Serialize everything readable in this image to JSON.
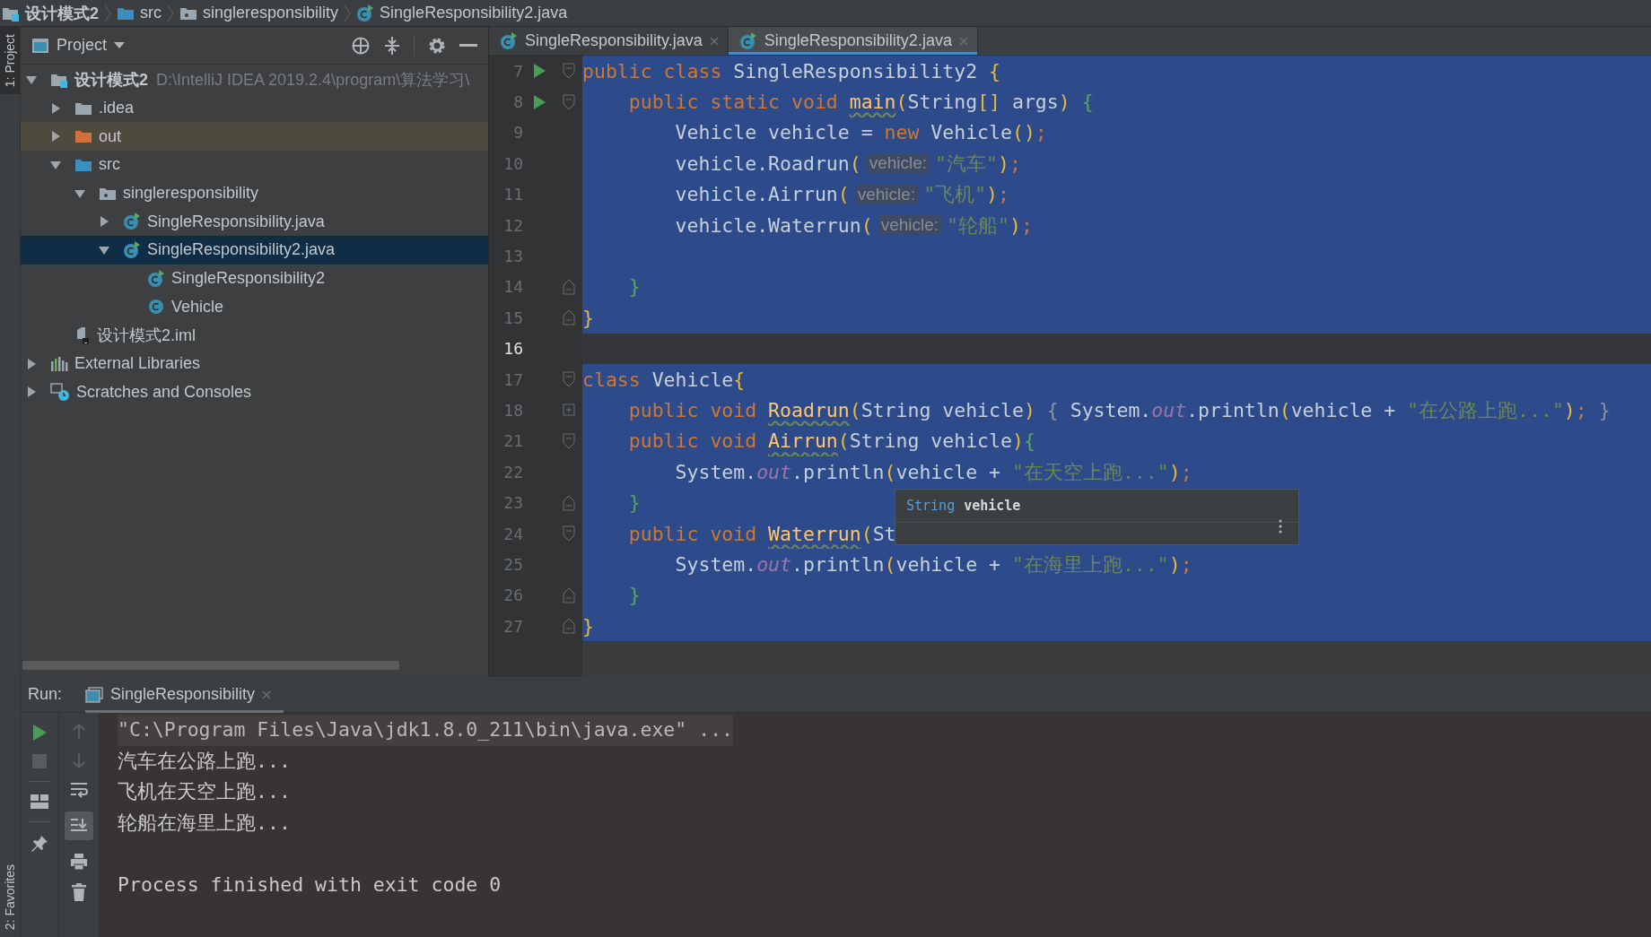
{
  "breadcrumb": [
    {
      "label": "设计模式2",
      "kind": "module"
    },
    {
      "label": "src",
      "kind": "source-folder"
    },
    {
      "label": "singleresponsibility",
      "kind": "package"
    },
    {
      "label": "SingleResponsibility2.java",
      "kind": "java-file"
    }
  ],
  "left_stripe": [
    {
      "label": "1: Project",
      "selected": true
    },
    {
      "label": "2: Favorites",
      "selected": false
    }
  ],
  "project": {
    "title": "Project",
    "tree": [
      {
        "label": "设计模式2",
        "kind": "module",
        "path": "D:\\IntelliJ IDEA 2019.2.4\\program\\算法学习\\",
        "expanded": true,
        "selected": false,
        "children": [
          {
            "label": ".idea",
            "kind": "folder",
            "expanded": false,
            "selected": false
          },
          {
            "label": "out",
            "kind": "excluded-folder",
            "expanded": false,
            "selected": false
          },
          {
            "label": "src",
            "kind": "source-folder",
            "expanded": true,
            "selected": false,
            "children": [
              {
                "label": "singleresponsibility",
                "kind": "package",
                "expanded": true,
                "selected": false,
                "children": [
                  {
                    "label": "SingleResponsibility.java",
                    "kind": "java-file",
                    "expanded": false,
                    "selected": false
                  },
                  {
                    "label": "SingleResponsibility2.java",
                    "kind": "java-file",
                    "expanded": true,
                    "selected": true,
                    "children": [
                      {
                        "label": "SingleResponsibility2",
                        "kind": "main-class",
                        "selected": false
                      },
                      {
                        "label": "Vehicle",
                        "kind": "class",
                        "selected": false
                      }
                    ]
                  }
                ]
              }
            ]
          },
          {
            "label": "设计模式2.iml",
            "kind": "iml",
            "selected": false
          }
        ]
      },
      {
        "label": "External Libraries",
        "kind": "libraries",
        "expanded": false,
        "selected": false
      },
      {
        "label": "Scratches and Consoles",
        "kind": "scratches",
        "expanded": false,
        "selected": false
      }
    ]
  },
  "editor": {
    "tabs": [
      {
        "label": "SingleResponsibility.java",
        "selected": false
      },
      {
        "label": "SingleResponsibility2.java",
        "selected": true
      }
    ],
    "lines": [
      {
        "number": "7",
        "run": true,
        "kind": "fold-start",
        "selected": true,
        "tokens": [
          {
            "kind": "kw",
            "text": "public class "
          },
          {
            "kind": "id",
            "text": "SingleResponsibility2 "
          },
          {
            "kind": "p1",
            "text": "{"
          }
        ]
      },
      {
        "number": "8",
        "run": true,
        "kind": "fold-start",
        "selected": true,
        "tokens": [
          {
            "kind": "kw",
            "text": "    public static void "
          },
          {
            "kind": "decl",
            "text": "main"
          },
          {
            "kind": "p1",
            "text": "("
          },
          {
            "kind": "id",
            "text": "String"
          },
          {
            "kind": "p1",
            "text": "[]"
          },
          {
            "kind": "id",
            "text": " args"
          },
          {
            "kind": "p1",
            "text": ")"
          },
          {
            "kind": "p2",
            "text": " {"
          }
        ]
      },
      {
        "number": "9",
        "run": false,
        "kind": "plain",
        "selected": true,
        "tokens": [
          {
            "kind": "id",
            "text": "        Vehicle vehicle = "
          },
          {
            "kind": "kw",
            "text": "new "
          },
          {
            "kind": "id",
            "text": "Vehicle"
          },
          {
            "kind": "p1",
            "text": "()"
          },
          {
            "kind": "punct",
            "text": ";"
          }
        ]
      },
      {
        "number": "10",
        "run": false,
        "kind": "plain",
        "selected": true,
        "tokens": [
          {
            "kind": "id",
            "text": "        vehicle.Roadrun"
          },
          {
            "kind": "p1",
            "text": "("
          },
          {
            "kind": "hint",
            "text": "vehicle:"
          },
          {
            "kind": "str",
            "text": "\"汽车\""
          },
          {
            "kind": "p1",
            "text": ")"
          },
          {
            "kind": "punct",
            "text": ";"
          }
        ]
      },
      {
        "number": "11",
        "run": false,
        "kind": "plain",
        "selected": true,
        "tokens": [
          {
            "kind": "id",
            "text": "        vehicle.Airrun"
          },
          {
            "kind": "p1",
            "text": "("
          },
          {
            "kind": "hint",
            "text": "vehicle:"
          },
          {
            "kind": "str",
            "text": "\"飞机\""
          },
          {
            "kind": "p1",
            "text": ")"
          },
          {
            "kind": "punct",
            "text": ";"
          }
        ]
      },
      {
        "number": "12",
        "run": false,
        "kind": "plain",
        "selected": true,
        "tokens": [
          {
            "kind": "id",
            "text": "        vehicle.Waterrun"
          },
          {
            "kind": "p1",
            "text": "("
          },
          {
            "kind": "hint",
            "text": "vehicle:"
          },
          {
            "kind": "str",
            "text": "\"轮船\""
          },
          {
            "kind": "p1",
            "text": ")"
          },
          {
            "kind": "punct",
            "text": ";"
          }
        ]
      },
      {
        "number": "13",
        "run": false,
        "kind": "plain",
        "selected": true
      },
      {
        "number": "14",
        "run": false,
        "kind": "fold-end",
        "selected": true,
        "tokens": [
          {
            "kind": "p2",
            "text": "    }"
          }
        ]
      },
      {
        "number": "15",
        "run": false,
        "kind": "fold-end",
        "selected": true,
        "tokens": [
          {
            "kind": "p1",
            "text": "}"
          }
        ]
      },
      {
        "number": "16",
        "run": false,
        "kind": "plain",
        "selected": false
      },
      {
        "number": "17",
        "run": false,
        "kind": "fold-start",
        "selected": true,
        "tokens": [
          {
            "kind": "kw",
            "text": "class "
          },
          {
            "kind": "id",
            "text": "Vehicle"
          },
          {
            "kind": "p1",
            "text": "{"
          }
        ]
      },
      {
        "number": "18",
        "run": false,
        "kind": "folded",
        "selected": true,
        "tokens": [
          {
            "kind": "kw",
            "text": "    public void "
          },
          {
            "kind": "decl",
            "text": "Roadrun"
          },
          {
            "kind": "p1",
            "text": "("
          },
          {
            "kind": "id",
            "text": "String vehicle"
          },
          {
            "kind": "p1",
            "text": ")"
          },
          {
            "kind": "folded",
            "text": " { "
          },
          {
            "kind": "id",
            "text": "System."
          },
          {
            "kind": "field",
            "text": "out"
          },
          {
            "kind": "id",
            "text": ".println"
          },
          {
            "kind": "p1",
            "text": "("
          },
          {
            "kind": "id",
            "text": "vehicle + "
          },
          {
            "kind": "str",
            "text": "\"在公路上跑...\""
          },
          {
            "kind": "p1",
            "text": ")"
          },
          {
            "kind": "punct",
            "text": ";"
          },
          {
            "kind": "folded",
            "text": " }"
          }
        ]
      },
      {
        "number": "21",
        "run": false,
        "kind": "fold-start",
        "selected": true,
        "tokens": [
          {
            "kind": "kw",
            "text": "    public void "
          },
          {
            "kind": "decl",
            "text": "Airrun"
          },
          {
            "kind": "p1",
            "text": "("
          },
          {
            "kind": "id",
            "text": "String vehicle"
          },
          {
            "kind": "p1",
            "text": ")"
          },
          {
            "kind": "p2",
            "text": "{"
          }
        ]
      },
      {
        "number": "22",
        "run": false,
        "kind": "plain",
        "selected": true,
        "tokens": [
          {
            "kind": "id",
            "text": "        System."
          },
          {
            "kind": "field",
            "text": "out"
          },
          {
            "kind": "id",
            "text": ".println"
          },
          {
            "kind": "p1",
            "text": "("
          },
          {
            "kind": "id",
            "text": "vehicle + "
          },
          {
            "kind": "str",
            "text": "\"在天空上跑...\""
          },
          {
            "kind": "p1",
            "text": ")"
          },
          {
            "kind": "punct",
            "text": ";"
          }
        ]
      },
      {
        "number": "23",
        "run": false,
        "kind": "fold-end",
        "selected": true,
        "tokens": [
          {
            "kind": "p2",
            "text": "    }"
          }
        ]
      },
      {
        "number": "24",
        "run": false,
        "kind": "fold-start",
        "selected": true,
        "tokens": [
          {
            "kind": "kw",
            "text": "    public void "
          },
          {
            "kind": "decl",
            "text": "Waterrun"
          },
          {
            "kind": "p1",
            "text": "("
          },
          {
            "kind": "id",
            "text": "St"
          }
        ]
      },
      {
        "number": "25",
        "run": false,
        "kind": "plain",
        "selected": true,
        "tokens": [
          {
            "kind": "id",
            "text": "        System."
          },
          {
            "kind": "field",
            "text": "out"
          },
          {
            "kind": "id",
            "text": ".println"
          },
          {
            "kind": "p1",
            "text": "("
          },
          {
            "kind": "id",
            "text": "vehicle + "
          },
          {
            "kind": "str",
            "text": "\"在海里上跑...\""
          },
          {
            "kind": "p1",
            "text": ")"
          },
          {
            "kind": "punct",
            "text": ";"
          }
        ]
      },
      {
        "number": "26",
        "run": false,
        "kind": "fold-end",
        "selected": true,
        "tokens": [
          {
            "kind": "p2",
            "text": "    }"
          }
        ]
      },
      {
        "number": "27",
        "run": false,
        "kind": "fold-end",
        "selected": true,
        "tokens": [
          {
            "kind": "p1",
            "text": "}"
          }
        ]
      }
    ],
    "tooltip": {
      "type": "String",
      "name": "vehicle"
    }
  },
  "run": {
    "label": "Run:",
    "tab": {
      "label": "SingleResponsibility",
      "selected": true
    },
    "scroll_to_end": true,
    "console": [
      {
        "kind": "command",
        "text": "\"C:\\Program Files\\Java\\jdk1.8.0_211\\bin\\java.exe\" ..."
      },
      {
        "kind": "output",
        "text": "汽车在公路上跑..."
      },
      {
        "kind": "output",
        "text": "飞机在天空上跑..."
      },
      {
        "kind": "output",
        "text": "轮船在海里上跑..."
      },
      {
        "kind": "blank"
      },
      {
        "kind": "output",
        "text": "Process finished with exit code 0"
      }
    ]
  }
}
